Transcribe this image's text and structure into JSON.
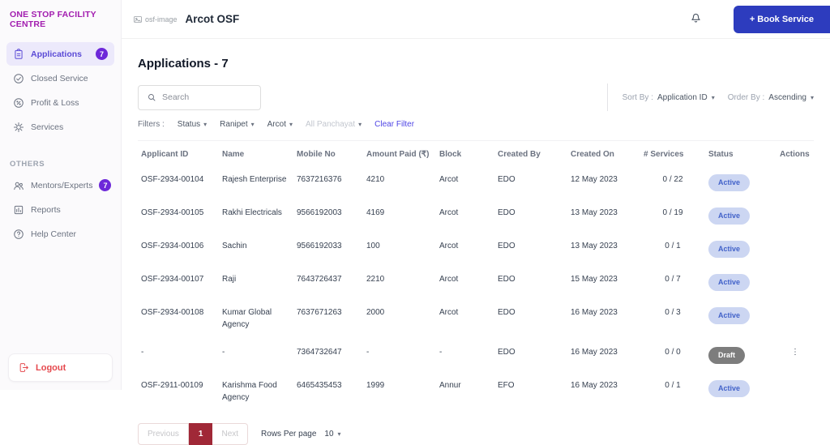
{
  "sidebar": {
    "logo": "ONE STOP FACILITY CENTRE",
    "items": [
      {
        "label": "Applications",
        "badge": "7"
      },
      {
        "label": "Closed Service"
      },
      {
        "label": "Profit & Loss"
      },
      {
        "label": "Services"
      }
    ],
    "others_label": "OTHERS",
    "others": [
      {
        "label": "Mentors/Experts",
        "badge": "7"
      },
      {
        "label": "Reports"
      },
      {
        "label": "Help Center"
      }
    ],
    "logout_label": "Logout"
  },
  "header": {
    "logo_text": "osf-image",
    "title": "Arcot OSF",
    "book_service_label": "+ Book Service"
  },
  "toolbar": {
    "heading": "Applications -  7",
    "search_placeholder": "Search",
    "filters_label": "Filters :",
    "filter_status": "Status",
    "filter_district": "Ranipet",
    "filter_block": "Arcot",
    "filter_panchayat": "All Panchayat",
    "clear_filter_label": "Clear Filter",
    "sort_by_label": "Sort By :",
    "sort_by_value": "Application ID",
    "order_by_label": "Order By :",
    "order_by_value": "Ascending"
  },
  "icons": {
    "chevron_down": "▾",
    "dots_vertical": "⋮"
  },
  "table": {
    "columns": [
      "Applicant ID",
      "Name",
      "Mobile No",
      "Amount Paid (₹)",
      "Block",
      "Created By",
      "Created On",
      "# Services",
      "Status",
      "Actions"
    ],
    "rows": [
      {
        "applicant_id": "OSF-2934-00104",
        "name": "Rajesh Enterprise",
        "mobile": "7637216376",
        "amount": "4210",
        "block": "Arcot",
        "created_by": "EDO",
        "created_on": "12 May 2023",
        "services": "0 / 22",
        "status": "Active",
        "actions": ""
      },
      {
        "applicant_id": "OSF-2934-00105",
        "name": "Rakhi Electricals",
        "mobile": "9566192003",
        "amount": "4169",
        "block": "Arcot",
        "created_by": "EDO",
        "created_on": "13 May 2023",
        "services": "0 / 19",
        "status": "Active",
        "actions": ""
      },
      {
        "applicant_id": "OSF-2934-00106",
        "name": "Sachin",
        "mobile": "9566192033",
        "amount": "100",
        "block": "Arcot",
        "created_by": "EDO",
        "created_on": "13 May 2023",
        "services": "0 / 1",
        "status": "Active",
        "actions": ""
      },
      {
        "applicant_id": "OSF-2934-00107",
        "name": "Raji",
        "mobile": "7643726437",
        "amount": "2210",
        "block": "Arcot",
        "created_by": "EDO",
        "created_on": "15 May 2023",
        "services": "0 / 7",
        "status": "Active",
        "actions": ""
      },
      {
        "applicant_id": "OSF-2934-00108",
        "name": "Kumar Global Agency",
        "mobile": "7637671263",
        "amount": "2000",
        "block": "Arcot",
        "created_by": "EDO",
        "created_on": "16 May 2023",
        "services": "0 / 3",
        "status": "Active",
        "actions": ""
      },
      {
        "applicant_id": "-",
        "name": "-",
        "mobile": "7364732647",
        "amount": "-",
        "block": "-",
        "created_by": "EDO",
        "created_on": "16 May 2023",
        "services": "0 / 0",
        "status": "Draft",
        "actions": "⋮"
      },
      {
        "applicant_id": "OSF-2911-00109",
        "name": "Karishma Food Agency",
        "mobile": "6465435453",
        "amount": "1999",
        "block": "Annur",
        "created_by": "EFO",
        "created_on": "16 May 2023",
        "services": "0 / 1",
        "status": "Active",
        "actions": ""
      }
    ]
  },
  "pagination": {
    "previous_label": "Previous",
    "current_page": "1",
    "next_label": "Next",
    "rows_per_page_label": "Rows Per page",
    "rows_per_page_value": "10"
  },
  "colors": {
    "brand_purple": "#a21caf",
    "accent_indigo": "#2d3cbe",
    "active_badge_bg": "#ccd6f2",
    "active_badge_text": "#4262c9",
    "draft_badge_bg": "#7d7d7d",
    "pagination_active_bg": "#a02837",
    "logout_red": "#e5484d",
    "sidebar_active_bg": "#ece9fb"
  }
}
